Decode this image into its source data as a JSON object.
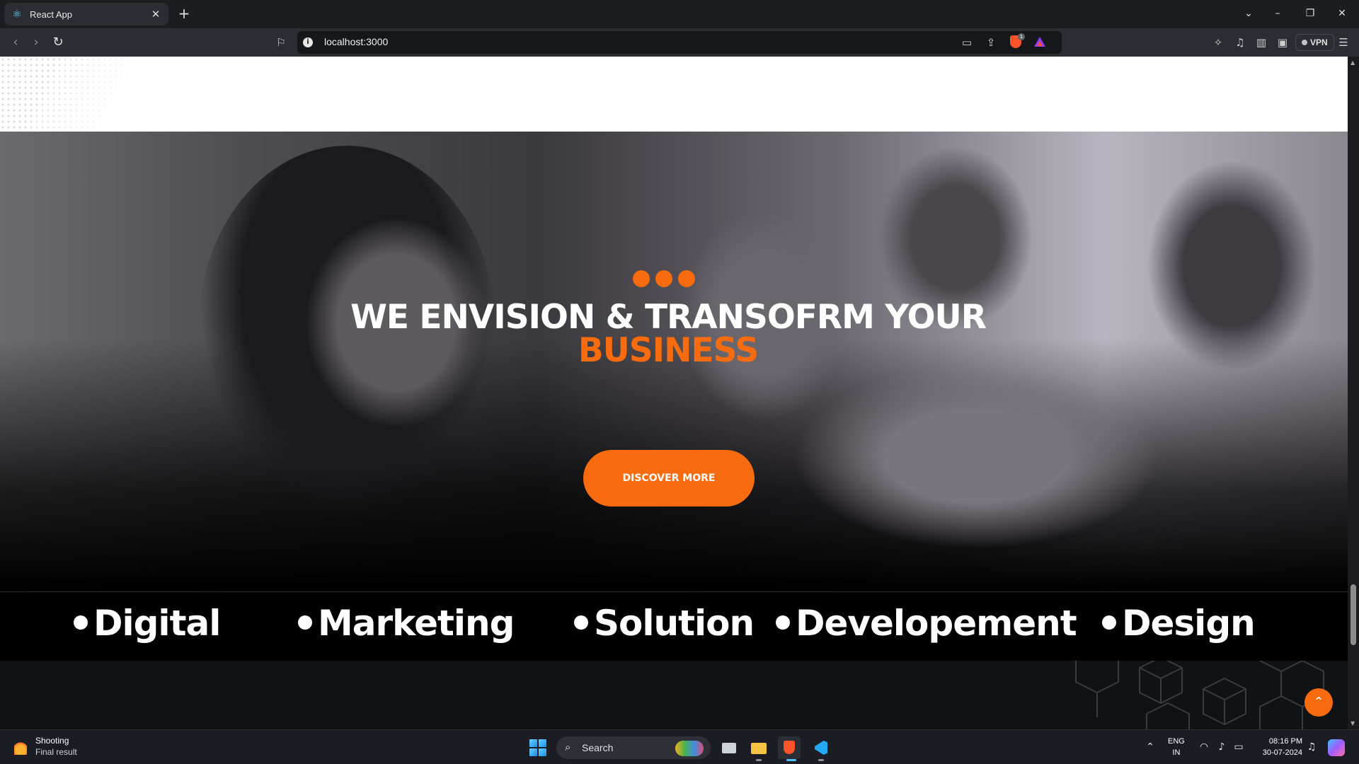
{
  "browser": {
    "tab_title": "React App",
    "url": "localhost:3000",
    "brave_badge": "1",
    "vpn_label": "VPN"
  },
  "hero": {
    "headline_line1": "WE ENVISION & TRANSOFRM YOUR",
    "headline_line2": "BUSINESS",
    "cta_label": "DISCOVER MORE",
    "accent_color": "#f86b0e"
  },
  "ticker": {
    "items": [
      "Digital",
      "Marketing",
      "Solution",
      "Developement",
      "Design"
    ]
  },
  "taskbar": {
    "weather_title": "Shooting",
    "weather_subtitle": "Final result",
    "search_placeholder": "Search",
    "lang_line1": "ENG",
    "lang_line2": "IN",
    "time": "08:16 PM",
    "date": "30-07-2024"
  },
  "icons": {
    "tab_favicon": "react-icon",
    "scroll_top": "chevron-up-icon"
  }
}
